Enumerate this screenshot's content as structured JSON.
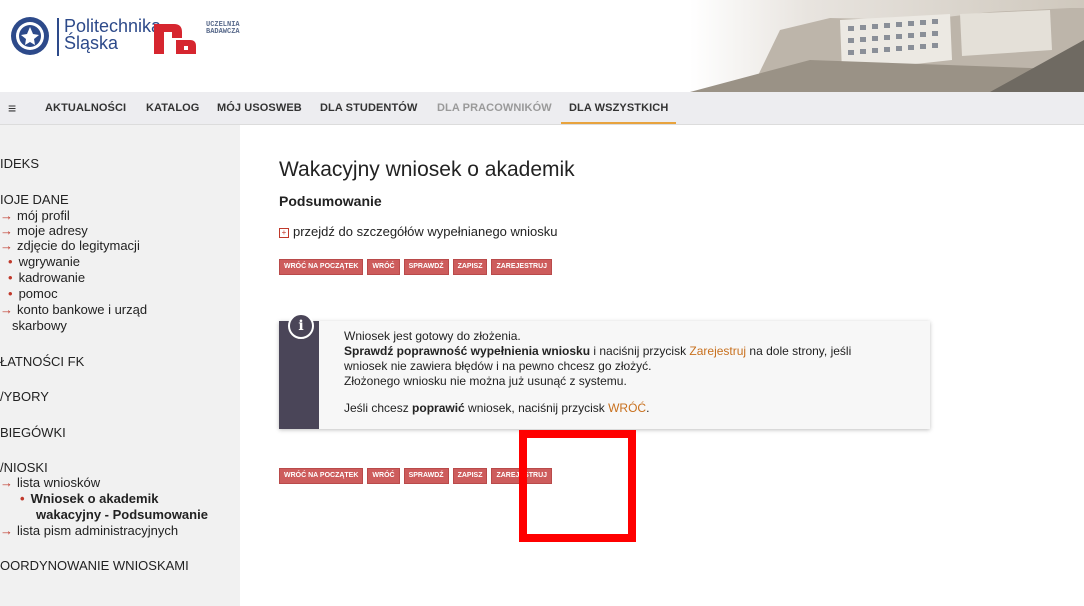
{
  "header": {
    "logo_line1": "Politechnika",
    "logo_line2": "Śląska",
    "logo_sub_line1": "UCZELNIA",
    "logo_sub_line2": "BADAWCZA",
    "brand_color": "#2d4a8a",
    "mark_color": "#d6262f"
  },
  "nav": {
    "menu_icon": "≡",
    "items": [
      {
        "label": "AKTUALNOŚCI"
      },
      {
        "label": "KATALOG"
      },
      {
        "label": "MÓJ USOSWEB"
      },
      {
        "label": "DLA STUDENTÓW"
      },
      {
        "label": "DLA PRACOWNIKÓW"
      },
      {
        "label": "DLA WSZYSTKICH"
      }
    ],
    "active_color": "#e8a33d"
  },
  "sidebar": {
    "indeks": "IDEKS",
    "moje_dane": "IOJE DANE",
    "moj_profil": "mój profil",
    "moje_adresy": "moje adresy",
    "zdjecie": "zdjęcie do legitymacji",
    "wgrywanie": "wgrywanie",
    "kadrowanie": "kadrowanie",
    "pomoc": "pomoc",
    "konto_line1": "konto bankowe i urząd",
    "konto_line2": "skarbowy",
    "platnosci": "ŁATNOŚCI FK",
    "wybory": "/YBORY",
    "biegowki": "BIEGÓWKI",
    "wnioski": "/NIOSKI",
    "lista_wnioskow": "lista wniosków",
    "current_line1": "Wniosek o akademik",
    "current_line2": "wakacyjny - Podsumowanie",
    "lista_pism": "lista pism administracyjnych",
    "koordynowanie": "OORDYNOWANIE WNIOSKAMI"
  },
  "main": {
    "title": "Wakacyjny wniosek o akademik",
    "subtitle": "Podsumowanie",
    "details_link": "przejdź do szczegółów wypełnianego wniosku",
    "buttons": {
      "start": "WRÓĆ NA POCZĄTEK",
      "back": "WRÓĆ",
      "check": "SPRAWDŹ",
      "save": "ZAPISZ",
      "register": "ZAREJESTRUJ"
    }
  },
  "info": {
    "icon": "i",
    "line1": "Wniosek jest gotowy do złożenia.",
    "line2_bold": "Sprawdź poprawność wypełnienia wniosku",
    "line2_mid": " i naciśnij przycisk ",
    "line2_link": "Zarejestruj",
    "line2_end": " na dole strony, jeśli",
    "line3": "wniosek nie zawiera błędów i na pewno chcesz go złożyć.",
    "line4": "Złożonego wniosku nie można już usunąć z systemu.",
    "line5_start": "Jeśli chcesz ",
    "line5_bold": "poprawić",
    "line5_mid": " wniosek, naciśnij przycisk ",
    "line5_link": "WRÓĆ",
    "line5_end": "."
  }
}
